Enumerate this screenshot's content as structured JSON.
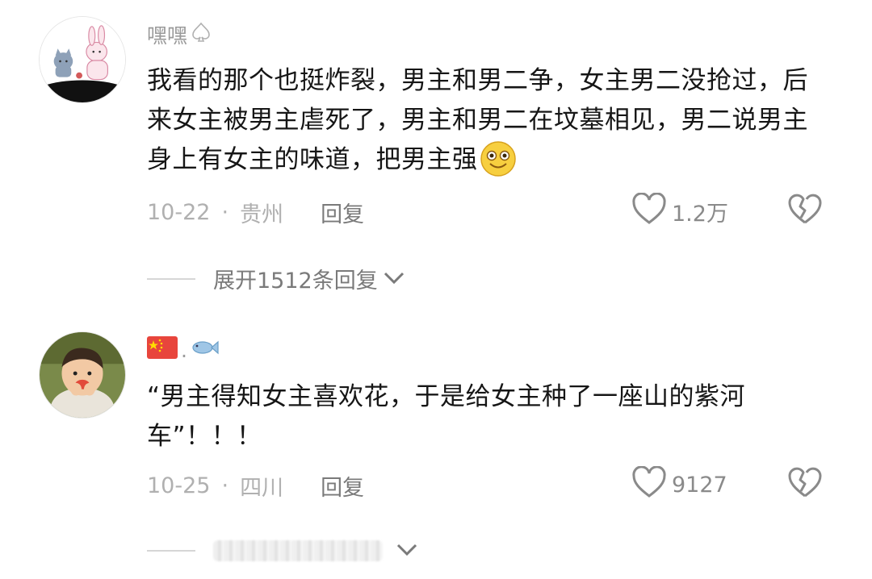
{
  "comments": [
    {
      "username": "嘿嘿",
      "text": "我看的那个也挺炸裂，男主和男二争，女主男二没抢过，后来女主被男主虐死了，男主和男二在坟墓相见，男二说男主身上有女主的味道，把男主强",
      "date": "10-22",
      "location": "贵州",
      "reply_label": "回复",
      "likes": "1.2万",
      "expand_label": "展开1512条回复"
    },
    {
      "username": ".",
      "text": "“男主得知女主喜欢花，于是给女主种了一座山的紫河车”！！！",
      "date": "10-25",
      "location": "四川",
      "reply_label": "回复",
      "likes": "9127"
    }
  ],
  "icons": {
    "badge": "spade-outline-icon",
    "emoji": "grinning-face-icon",
    "flag": "china-flag-icon",
    "fish": "fish-icon",
    "like": "heart-outline-icon",
    "dislike": "broken-heart-icon",
    "expand": "chevron-down-icon"
  },
  "colors": {
    "text": "#161616",
    "meta": "#b0b0b0",
    "username": "#9a9a9a"
  }
}
